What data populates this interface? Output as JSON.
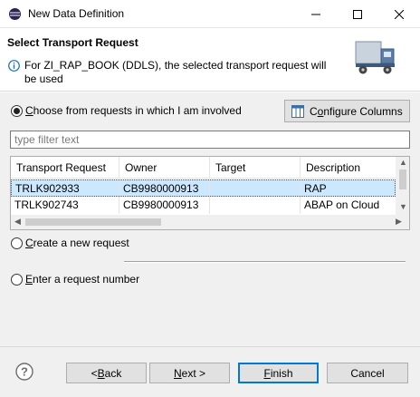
{
  "window": {
    "title": "New Data Definition",
    "min_icon": "minimize-icon",
    "max_icon": "maximize-icon",
    "close_icon": "close-icon"
  },
  "header": {
    "title": "Select Transport Request",
    "message": "For ZI_RAP_BOOK (DDLS), the selected transport request will be used",
    "icons": {
      "info": "info-icon",
      "banner": "transport-truck-icon"
    }
  },
  "options": {
    "involved": {
      "pre": "",
      "mn": "C",
      "post": "hoose from requests in which I am involved",
      "checked": true
    },
    "create": {
      "pre": "",
      "mn": "C",
      "post": "reate a new request",
      "checked": false
    },
    "enter": {
      "pre": "",
      "mn": "E",
      "post": "nter a request number",
      "checked": false
    }
  },
  "configure_button": {
    "pre": "C",
    "mn": "o",
    "post": "nfigure Columns",
    "icon": "table-columns-icon"
  },
  "filter": {
    "placeholder": "type filter text",
    "value": ""
  },
  "table": {
    "columns": [
      "Transport Request",
      "Owner",
      "Target",
      "Description"
    ],
    "rows": [
      {
        "request": "TRLK902933",
        "owner": "CB9980000913",
        "target": "",
        "description": "RAP",
        "selected": true
      },
      {
        "request": "TRLK902743",
        "owner": "CB9980000913",
        "target": "",
        "description": "ABAP on Cloud",
        "selected": false
      }
    ]
  },
  "buttons": {
    "back": {
      "pre": "< ",
      "mn": "B",
      "post": "ack"
    },
    "next": {
      "pre": "",
      "mn": "N",
      "post": "ext >"
    },
    "finish": {
      "pre": "",
      "mn": "F",
      "post": "inish"
    },
    "cancel": {
      "pre": "",
      "mn": "",
      "post": "Cancel"
    },
    "help_icon": "help-icon"
  },
  "colors": {
    "selection": "#cce8ff",
    "default_button_border": "#0078d7",
    "dialog_background": "#f0f0f0"
  }
}
